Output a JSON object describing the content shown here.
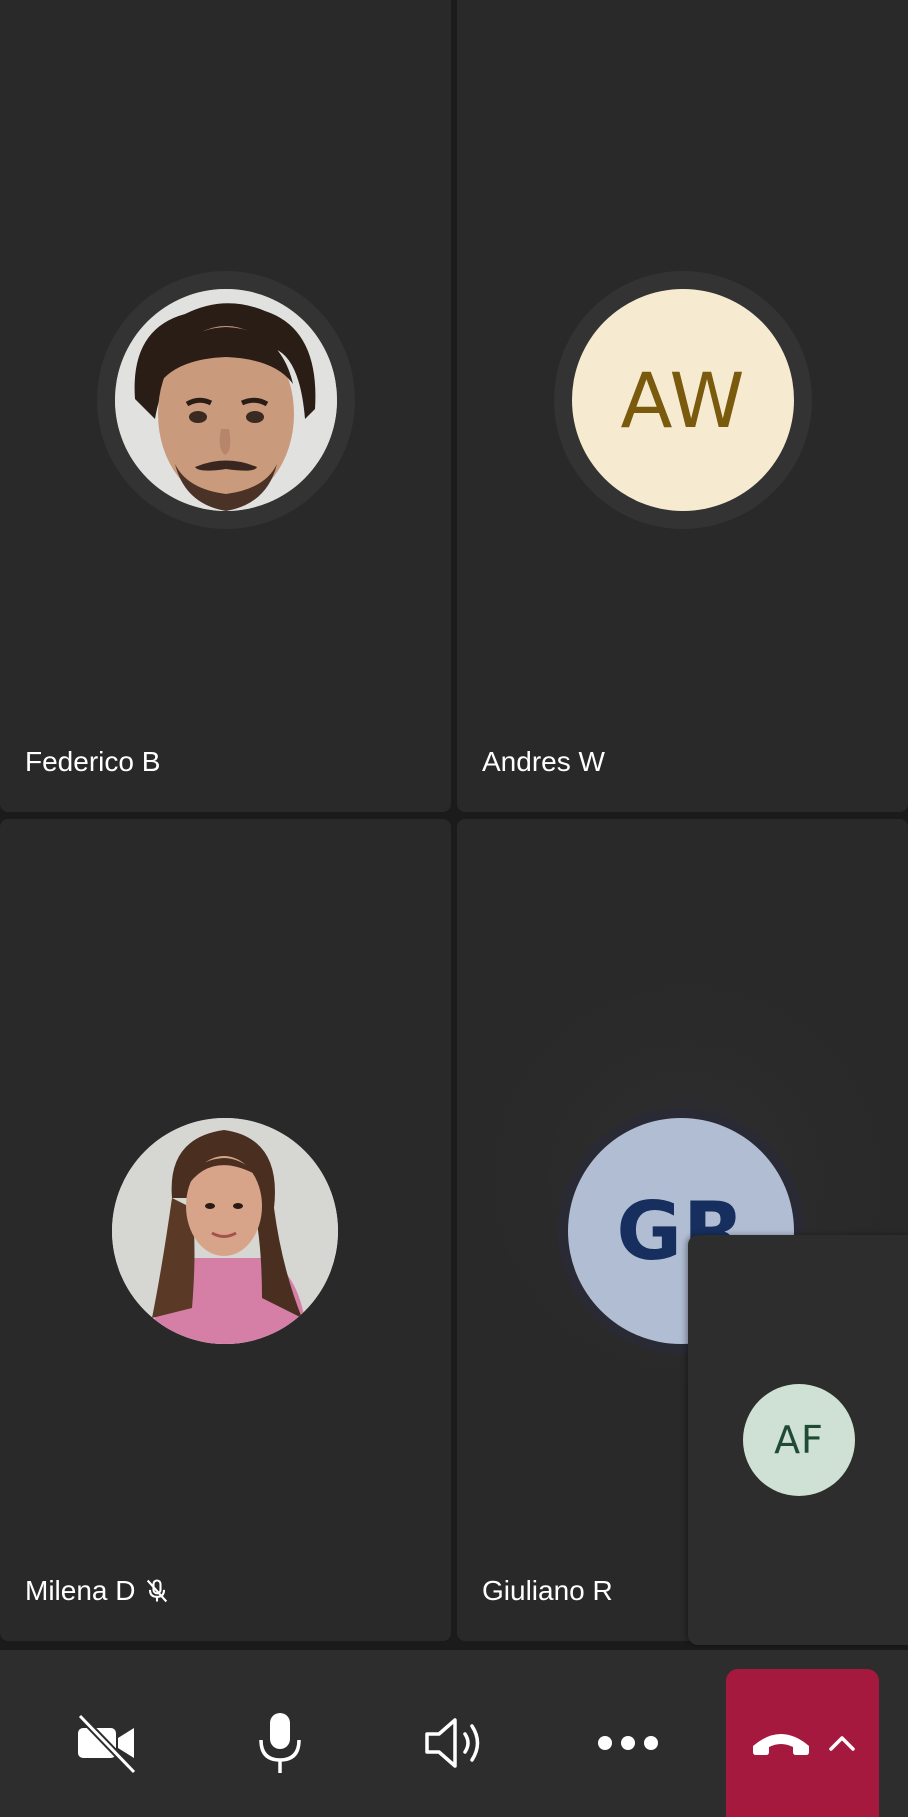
{
  "participants": [
    {
      "name": "Federico B",
      "avatar_type": "photo",
      "muted": false
    },
    {
      "name": "Andres W",
      "avatar_type": "initials",
      "initials": "AW",
      "avatar_bg": "#f6ebd1",
      "initials_color": "#7a5a0c",
      "muted": false
    },
    {
      "name": "Milena D",
      "avatar_type": "photo",
      "muted": true
    },
    {
      "name": "Giuliano R",
      "avatar_type": "initials",
      "initials": "GR",
      "avatar_bg": "#b0bdd3",
      "initials_color": "#162f5e",
      "muted": false
    }
  ],
  "self_view": {
    "initials": "AF",
    "avatar_bg": "#cfe1d5",
    "initials_color": "#1f4a34"
  },
  "controls": {
    "camera": {
      "icon": "video-off-icon",
      "state": "off"
    },
    "microphone": {
      "icon": "microphone-icon",
      "state": "on"
    },
    "speaker": {
      "icon": "speaker-icon",
      "state": "on"
    },
    "more": {
      "icon": "more-horizontal-icon"
    },
    "hangup": {
      "icon": "phone-hangup-icon",
      "expand_icon": "chevron-up-icon",
      "color": "#a4193d"
    }
  },
  "colors": {
    "tile_bg": "#292929",
    "app_bg": "#1b1b1b",
    "control_bar_bg": "#2d2d2d"
  }
}
